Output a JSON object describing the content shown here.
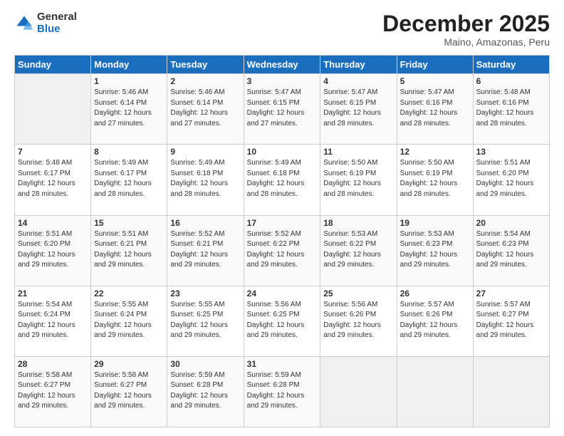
{
  "logo": {
    "general": "General",
    "blue": "Blue"
  },
  "header": {
    "month": "December 2025",
    "location": "Maino, Amazonas, Peru"
  },
  "weekdays": [
    "Sunday",
    "Monday",
    "Tuesday",
    "Wednesday",
    "Thursday",
    "Friday",
    "Saturday"
  ],
  "weeks": [
    [
      {
        "day": "",
        "info": ""
      },
      {
        "day": "1",
        "info": "Sunrise: 5:46 AM\nSunset: 6:14 PM\nDaylight: 12 hours\nand 27 minutes."
      },
      {
        "day": "2",
        "info": "Sunrise: 5:46 AM\nSunset: 6:14 PM\nDaylight: 12 hours\nand 27 minutes."
      },
      {
        "day": "3",
        "info": "Sunrise: 5:47 AM\nSunset: 6:15 PM\nDaylight: 12 hours\nand 27 minutes."
      },
      {
        "day": "4",
        "info": "Sunrise: 5:47 AM\nSunset: 6:15 PM\nDaylight: 12 hours\nand 28 minutes."
      },
      {
        "day": "5",
        "info": "Sunrise: 5:47 AM\nSunset: 6:16 PM\nDaylight: 12 hours\nand 28 minutes."
      },
      {
        "day": "6",
        "info": "Sunrise: 5:48 AM\nSunset: 6:16 PM\nDaylight: 12 hours\nand 28 minutes."
      }
    ],
    [
      {
        "day": "7",
        "info": "Sunrise: 5:48 AM\nSunset: 6:17 PM\nDaylight: 12 hours\nand 28 minutes."
      },
      {
        "day": "8",
        "info": "Sunrise: 5:49 AM\nSunset: 6:17 PM\nDaylight: 12 hours\nand 28 minutes."
      },
      {
        "day": "9",
        "info": "Sunrise: 5:49 AM\nSunset: 6:18 PM\nDaylight: 12 hours\nand 28 minutes."
      },
      {
        "day": "10",
        "info": "Sunrise: 5:49 AM\nSunset: 6:18 PM\nDaylight: 12 hours\nand 28 minutes."
      },
      {
        "day": "11",
        "info": "Sunrise: 5:50 AM\nSunset: 6:19 PM\nDaylight: 12 hours\nand 28 minutes."
      },
      {
        "day": "12",
        "info": "Sunrise: 5:50 AM\nSunset: 6:19 PM\nDaylight: 12 hours\nand 28 minutes."
      },
      {
        "day": "13",
        "info": "Sunrise: 5:51 AM\nSunset: 6:20 PM\nDaylight: 12 hours\nand 29 minutes."
      }
    ],
    [
      {
        "day": "14",
        "info": "Sunrise: 5:51 AM\nSunset: 6:20 PM\nDaylight: 12 hours\nand 29 minutes."
      },
      {
        "day": "15",
        "info": "Sunrise: 5:51 AM\nSunset: 6:21 PM\nDaylight: 12 hours\nand 29 minutes."
      },
      {
        "day": "16",
        "info": "Sunrise: 5:52 AM\nSunset: 6:21 PM\nDaylight: 12 hours\nand 29 minutes."
      },
      {
        "day": "17",
        "info": "Sunrise: 5:52 AM\nSunset: 6:22 PM\nDaylight: 12 hours\nand 29 minutes."
      },
      {
        "day": "18",
        "info": "Sunrise: 5:53 AM\nSunset: 6:22 PM\nDaylight: 12 hours\nand 29 minutes."
      },
      {
        "day": "19",
        "info": "Sunrise: 5:53 AM\nSunset: 6:23 PM\nDaylight: 12 hours\nand 29 minutes."
      },
      {
        "day": "20",
        "info": "Sunrise: 5:54 AM\nSunset: 6:23 PM\nDaylight: 12 hours\nand 29 minutes."
      }
    ],
    [
      {
        "day": "21",
        "info": "Sunrise: 5:54 AM\nSunset: 6:24 PM\nDaylight: 12 hours\nand 29 minutes."
      },
      {
        "day": "22",
        "info": "Sunrise: 5:55 AM\nSunset: 6:24 PM\nDaylight: 12 hours\nand 29 minutes."
      },
      {
        "day": "23",
        "info": "Sunrise: 5:55 AM\nSunset: 6:25 PM\nDaylight: 12 hours\nand 29 minutes."
      },
      {
        "day": "24",
        "info": "Sunrise: 5:56 AM\nSunset: 6:25 PM\nDaylight: 12 hours\nand 29 minutes."
      },
      {
        "day": "25",
        "info": "Sunrise: 5:56 AM\nSunset: 6:26 PM\nDaylight: 12 hours\nand 29 minutes."
      },
      {
        "day": "26",
        "info": "Sunrise: 5:57 AM\nSunset: 6:26 PM\nDaylight: 12 hours\nand 29 minutes."
      },
      {
        "day": "27",
        "info": "Sunrise: 5:57 AM\nSunset: 6:27 PM\nDaylight: 12 hours\nand 29 minutes."
      }
    ],
    [
      {
        "day": "28",
        "info": "Sunrise: 5:58 AM\nSunset: 6:27 PM\nDaylight: 12 hours\nand 29 minutes."
      },
      {
        "day": "29",
        "info": "Sunrise: 5:58 AM\nSunset: 6:27 PM\nDaylight: 12 hours\nand 29 minutes."
      },
      {
        "day": "30",
        "info": "Sunrise: 5:59 AM\nSunset: 6:28 PM\nDaylight: 12 hours\nand 29 minutes."
      },
      {
        "day": "31",
        "info": "Sunrise: 5:59 AM\nSunset: 6:28 PM\nDaylight: 12 hours\nand 29 minutes."
      },
      {
        "day": "",
        "info": ""
      },
      {
        "day": "",
        "info": ""
      },
      {
        "day": "",
        "info": ""
      }
    ]
  ]
}
